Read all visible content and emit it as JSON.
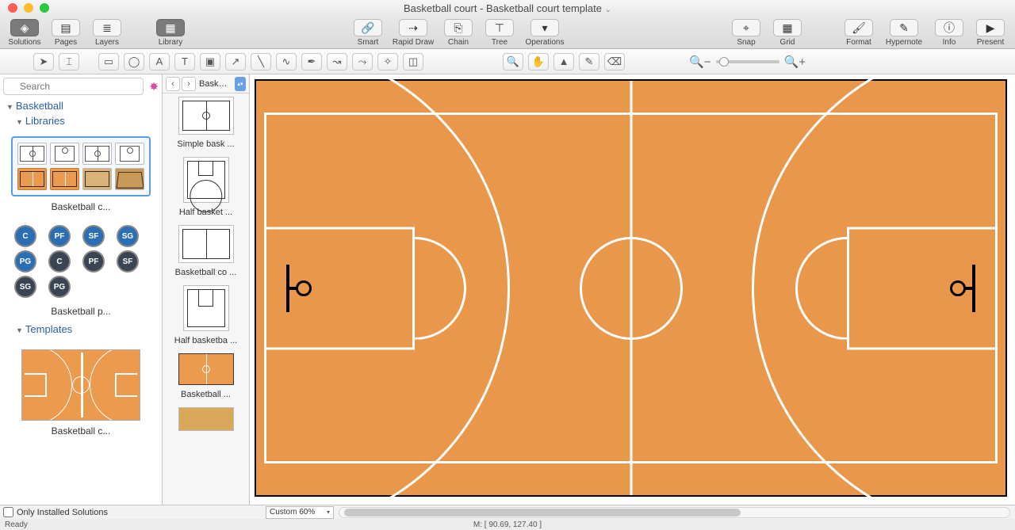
{
  "window": {
    "title": "Basketball court - Basketball court template"
  },
  "toolbar": {
    "solutions": "Solutions",
    "pages": "Pages",
    "layers": "Layers",
    "library": "Library",
    "smart": "Smart",
    "rapid_draw": "Rapid Draw",
    "chain": "Chain",
    "tree": "Tree",
    "operations": "Operations",
    "snap": "Snap",
    "grid": "Grid",
    "format": "Format",
    "hypernote": "Hypernote",
    "info": "Info",
    "present": "Present"
  },
  "search": {
    "placeholder": "Search"
  },
  "tree": {
    "root": "Basketball",
    "libraries": "Libraries",
    "templates": "Templates"
  },
  "libs": {
    "courts_label": "Basketball c...",
    "positions_label": "Basketball p...",
    "template_label": "Basketball c..."
  },
  "positions": [
    "C",
    "PF",
    "SF",
    "SG",
    "PG",
    "C",
    "PF",
    "SF",
    "SG",
    "PG"
  ],
  "gallery": {
    "title": "Basket...",
    "items": [
      "Simple bask ...",
      "Half basket ...",
      "Basketball co ...",
      "Half basketba ...",
      "Basketball ...",
      ""
    ]
  },
  "footer": {
    "only_installed": "Only Installed Solutions",
    "zoom": "Custom 60%",
    "coords": "M: [ 90.69, 127.40 ]"
  },
  "status": {
    "text": "Ready"
  }
}
